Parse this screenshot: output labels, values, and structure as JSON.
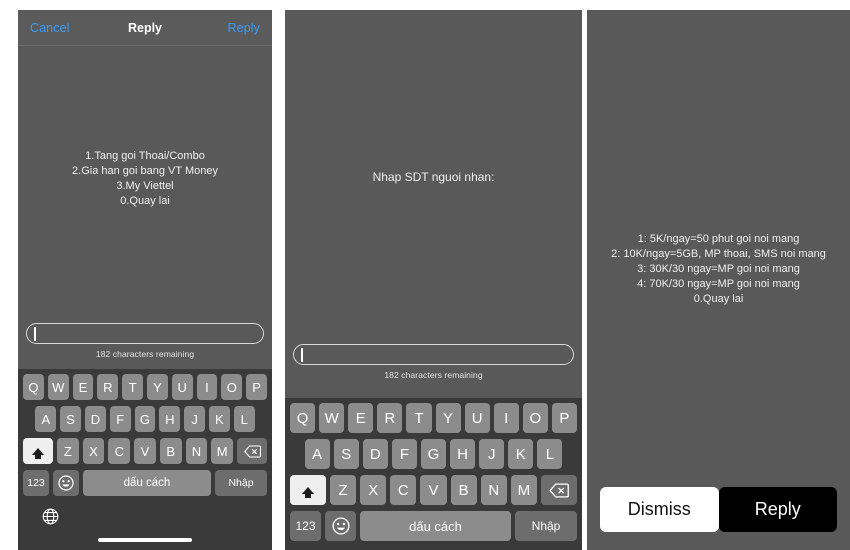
{
  "colors": {
    "panel_bg": "#595959",
    "keyboard_bg": "#3a3a3a",
    "key_bg": "#8c8c8c",
    "key_dark_bg": "#6d6d6d",
    "key_light_bg": "#efefef",
    "nav_action": "#3b9bf5",
    "button_primary_bg": "#000000",
    "button_secondary_bg": "#ffffff"
  },
  "panel1": {
    "navbar": {
      "cancel_label": "Cancel",
      "title": "Reply",
      "reply_label": "Reply"
    },
    "message_lines": [
      "1.Tang goi Thoai/Combo",
      "2.Gia han goi bang VT Money",
      "3.My Viettel",
      "0.Quay lai"
    ],
    "compose": {
      "value": "",
      "placeholder": "",
      "char_count": "182 characters remaining"
    }
  },
  "panel2": {
    "message_lines": [
      "Nhap SDT nguoi nhan:"
    ],
    "compose": {
      "value": "",
      "placeholder": "",
      "char_count": "182 characters remaining"
    }
  },
  "panel3": {
    "message_lines": [
      "1: 5K/ngay=50 phut goi noi mang",
      "2: 10K/ngay=5GB, MP thoai, SMS noi mang",
      "3: 30K/30 ngay=MP goi noi mang",
      "4: 70K/30 ngay=MP goi noi mang",
      "0.Quay lai"
    ],
    "actions": {
      "dismiss_label": "Dismiss",
      "reply_label": "Reply"
    }
  },
  "keyboard": {
    "row1": [
      "Q",
      "W",
      "E",
      "R",
      "T",
      "Y",
      "U",
      "I",
      "O",
      "P"
    ],
    "row2": [
      "A",
      "S",
      "D",
      "F",
      "G",
      "H",
      "J",
      "K",
      "L"
    ],
    "row3": [
      "Z",
      "X",
      "C",
      "V",
      "B",
      "N",
      "M"
    ],
    "shift_icon": "shift-icon",
    "backspace_icon": "backspace-icon",
    "numbers_label": "123",
    "emoji_icon": "emoji-icon",
    "space_label": "dấu cách",
    "enter_label": "Nhập",
    "globe_icon": "globe-icon"
  }
}
